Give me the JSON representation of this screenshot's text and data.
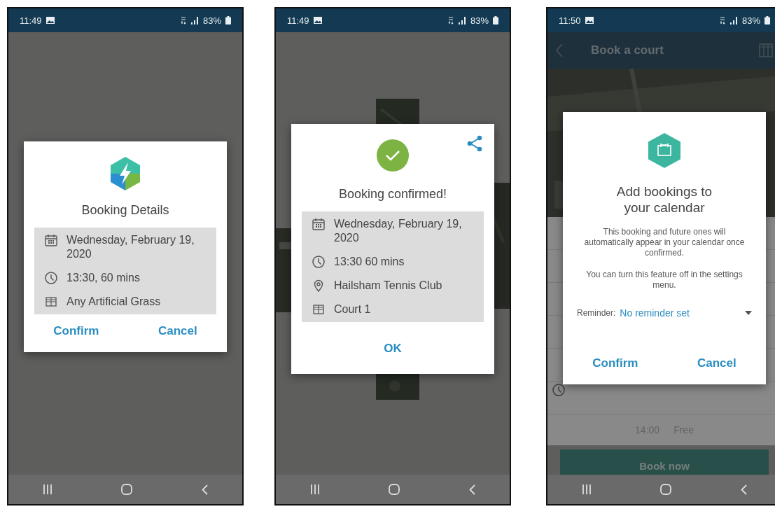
{
  "screens": [
    {
      "kind": "details",
      "status_bar": {
        "time": "11:49",
        "battery": "83%"
      },
      "dialog": {
        "title": "Booking Details",
        "details": [
          {
            "kind": "date",
            "text": "Wednesday, February 19, 2020"
          },
          {
            "kind": "time",
            "text": "13:30, 60 mins"
          },
          {
            "kind": "court",
            "text": "Any Artificial Grass"
          }
        ],
        "buttons": [
          "Confirm",
          "Cancel"
        ]
      }
    },
    {
      "kind": "confirmed",
      "status_bar": {
        "time": "11:49",
        "battery": "83%"
      },
      "dialog": {
        "title": "Booking confirmed!",
        "details": [
          {
            "kind": "date",
            "text": "Wednesday, February 19, 2020"
          },
          {
            "kind": "time",
            "text": "13:30 60 mins"
          },
          {
            "kind": "location",
            "text": "Hailsham Tennis Club"
          },
          {
            "kind": "court",
            "text": "Court 1"
          }
        ],
        "buttons": [
          "OK"
        ]
      }
    },
    {
      "kind": "calendar",
      "status_bar": {
        "time": "11:50",
        "battery": "83%"
      },
      "app_bar": {
        "title": "Book a court"
      },
      "slots": [
        {
          "time": "14:00",
          "status": "Free"
        }
      ],
      "action_button": "Book now",
      "dialog": {
        "title": "Add bookings to your calendar",
        "paragraphs": [
          "This booking and future ones will automatically appear in your calendar once confirmed.",
          "You can turn this feature off in the settings menu."
        ],
        "reminder": {
          "label": "Reminder:",
          "value": "No reminder set"
        },
        "buttons": [
          "Confirm",
          "Cancel"
        ]
      }
    }
  ]
}
